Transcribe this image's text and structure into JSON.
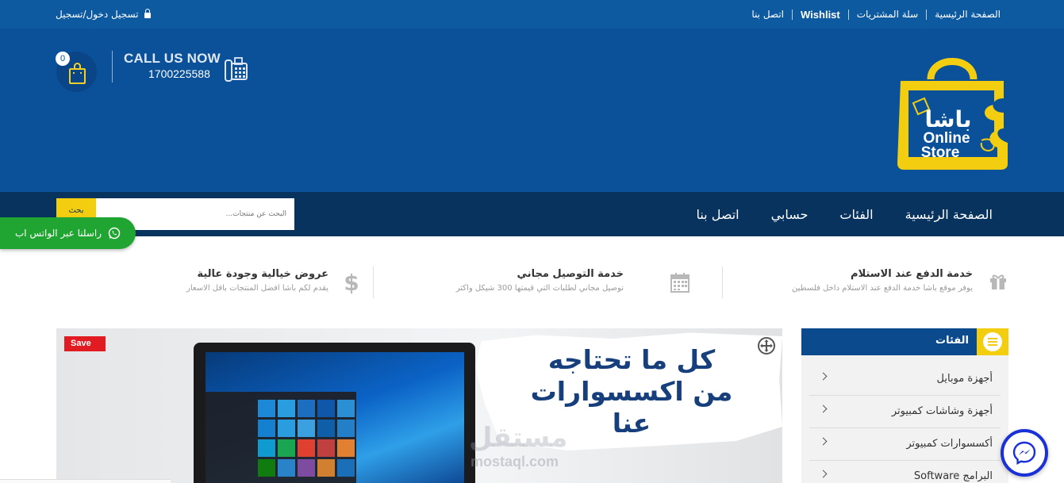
{
  "topbar": {
    "links": [
      "الصفحة الرئيسية",
      "سلة المشتريات",
      "Wishlist",
      "اتصل بنا"
    ],
    "login_label": "تسجيل دخول/تسجيل"
  },
  "header": {
    "cart_count": "0",
    "call_label": "CALL US NOW",
    "phone": "1700225588",
    "logo": {
      "arabic": "باشا",
      "line1": "Online",
      "line2": "Store"
    }
  },
  "nav": {
    "items": [
      "الصفحة الرئيسية",
      "الفئات",
      "حسابي",
      "اتصل بنا"
    ],
    "search_placeholder": "البحث عن منتجات...",
    "search_button": "بحث"
  },
  "whatsapp": {
    "label": "راسلنا عبر الواتس اب"
  },
  "features": [
    {
      "icon": "gift-icon",
      "title": "خدمة الدفع عند الاستلام",
      "desc": "يوفر موقع باشا خدمة الدفع عند الاستلام داخل فلسطين"
    },
    {
      "icon": "calendar-icon",
      "title": "خدمة التوصيل مجاني",
      "desc": "توصيل مجاني لطلبات التي قيمتها 300 شيكل واكثر"
    },
    {
      "icon": "dollar-icon",
      "title": "عروض خيالية وجودة عالية",
      "desc": "يقدم لكم باشا افضل المنتجات باقل الاسعار"
    }
  ],
  "banner": {
    "slogan_line1": "كل ما تحتاجه",
    "slogan_line2": "من اكسسوارات",
    "slogan_line3": "عنا",
    "watermark": "مستقل",
    "watermark_url": "mostaql.com",
    "badge": "Save"
  },
  "categories": {
    "title": "الفئات",
    "items": [
      "أجهزة موبايل",
      "أجهزة وشاشات كمبيوتر",
      "أكسسوارات كمبيوتر",
      "البرامج Software"
    ]
  },
  "colors": {
    "topbar": "#0d5aa0",
    "header": "#0a519a",
    "navbar": "#08335e",
    "accent_yellow": "#f3ce10",
    "whatsapp_green": "#21a532",
    "messenger_blue": "#1a31d8"
  }
}
